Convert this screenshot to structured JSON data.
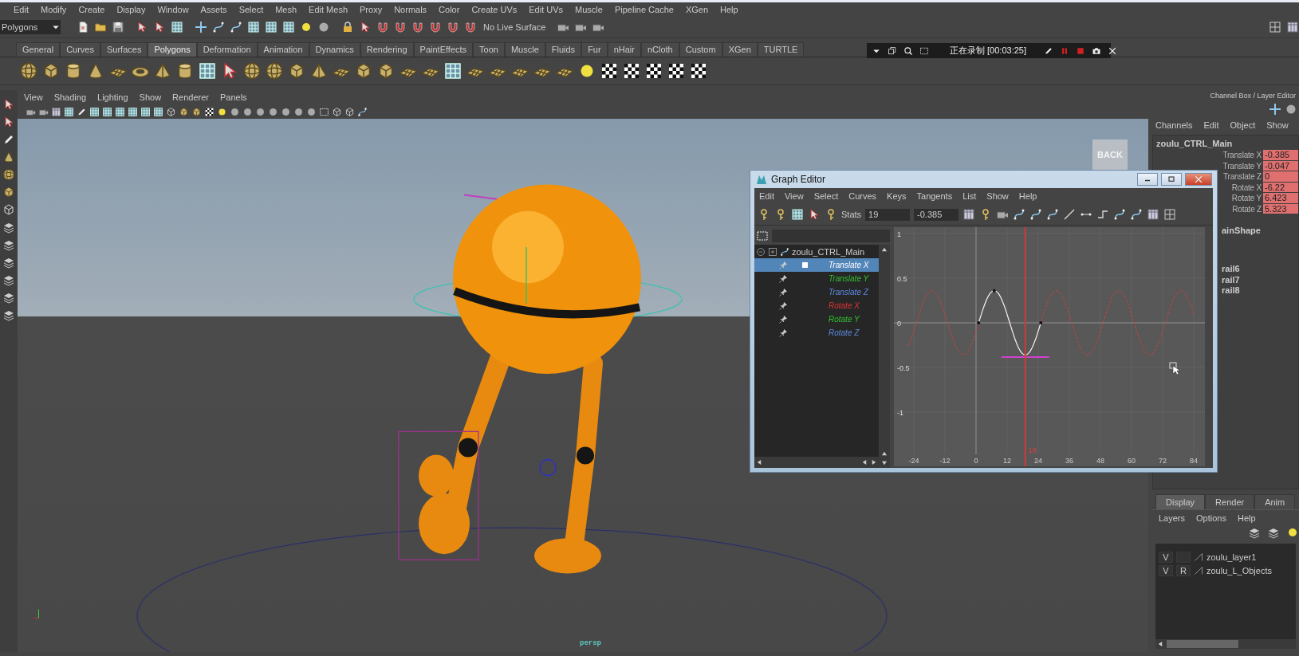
{
  "menubar": [
    "Edit",
    "Modify",
    "Create",
    "Display",
    "Window",
    "Assets",
    "Select",
    "Mesh",
    "Edit Mesh",
    "Proxy",
    "Normals",
    "Color",
    "Create UVs",
    "Edit UVs",
    "Muscle",
    "Pipeline Cache",
    "XGen",
    "Help"
  ],
  "status_line": {
    "mode": "Polygons",
    "live_surface": "No Live Surface"
  },
  "shelf_tabs": [
    {
      "label": "General",
      "selected": false
    },
    {
      "label": "Curves",
      "selected": false
    },
    {
      "label": "Surfaces",
      "selected": false
    },
    {
      "label": "Polygons",
      "selected": true
    },
    {
      "label": "Deformation",
      "selected": false
    },
    {
      "label": "Animation",
      "selected": false
    },
    {
      "label": "Dynamics",
      "selected": false
    },
    {
      "label": "Rendering",
      "selected": false
    },
    {
      "label": "PaintEffects",
      "selected": false
    },
    {
      "label": "Toon",
      "selected": false
    },
    {
      "label": "Muscle",
      "selected": false
    },
    {
      "label": "Fluids",
      "selected": false
    },
    {
      "label": "Fur",
      "selected": false
    },
    {
      "label": "nHair",
      "selected": false
    },
    {
      "label": "nCloth",
      "selected": false
    },
    {
      "label": "Custom",
      "selected": false
    },
    {
      "label": "XGen",
      "selected": false
    },
    {
      "label": "TURTLE",
      "selected": false
    }
  ],
  "recording_bar": {
    "status": "正在录制 [00:03:25]"
  },
  "panel_menu": [
    "View",
    "Shading",
    "Lighting",
    "Show",
    "Renderer",
    "Panels"
  ],
  "viewport": {
    "back_button": "BACK",
    "camera_label": "persp"
  },
  "graph_editor": {
    "title": "Graph Editor",
    "menu": [
      "Edit",
      "View",
      "Select",
      "Curves",
      "Keys",
      "Tangents",
      "List",
      "Show",
      "Help"
    ],
    "stats_label": "Stats",
    "stats_frame": "19",
    "stats_value": "-0.385",
    "node": "zoulu_CTRL_Main",
    "channels": [
      {
        "name": "Translate X",
        "selected": true
      },
      {
        "name": "Translate Y",
        "selected": false,
        "color": "#30c030"
      },
      {
        "name": "Translate Z",
        "selected": false,
        "color": "#5a8ae0"
      },
      {
        "name": "Rotate X",
        "selected": false,
        "color": "#e03030"
      },
      {
        "name": "Rotate Y",
        "selected": false,
        "color": "#30c030"
      },
      {
        "name": "Rotate Z",
        "selected": false,
        "color": "#5a8ae0"
      }
    ],
    "y_ticks": [
      "1",
      "0.5",
      "0",
      "-0.5",
      "-1"
    ],
    "x_ticks": [
      "-24",
      "-12",
      "0",
      "12",
      "24",
      "36",
      "48",
      "60",
      "72",
      "84"
    ],
    "current_frame": "19"
  },
  "channel_box": {
    "title": "Channel Box / Layer Editor",
    "menu": [
      "Channels",
      "Edit",
      "Object",
      "Show"
    ],
    "node": "zoulu_CTRL_Main",
    "attributes": [
      {
        "name": "Translate X",
        "value": "-0.385",
        "keyed": true
      },
      {
        "name": "Translate Y",
        "value": "-0.047",
        "keyed": true
      },
      {
        "name": "Translate Z",
        "value": "0",
        "keyed": true
      },
      {
        "name": "Rotate X",
        "value": "-6.22",
        "keyed": true
      },
      {
        "name": "Rotate Y",
        "value": "6.423",
        "keyed": true
      },
      {
        "name": "Rotate Z",
        "value": "5.323",
        "keyed": true
      }
    ],
    "shape": "ainShape",
    "inputs": [
      "rail6",
      "rail7",
      "rail8"
    ]
  },
  "layer_editor": {
    "tabs": [
      {
        "label": "Display",
        "selected": true
      },
      {
        "label": "Render",
        "selected": false
      },
      {
        "label": "Anim",
        "selected": false
      }
    ],
    "menu": [
      "Layers",
      "Options",
      "Help"
    ],
    "layers": [
      {
        "visible": "V",
        "name": "zoulu_layer1"
      },
      {
        "visible": "V",
        "render": "R",
        "name": "zoulu_L_Objects"
      }
    ]
  }
}
